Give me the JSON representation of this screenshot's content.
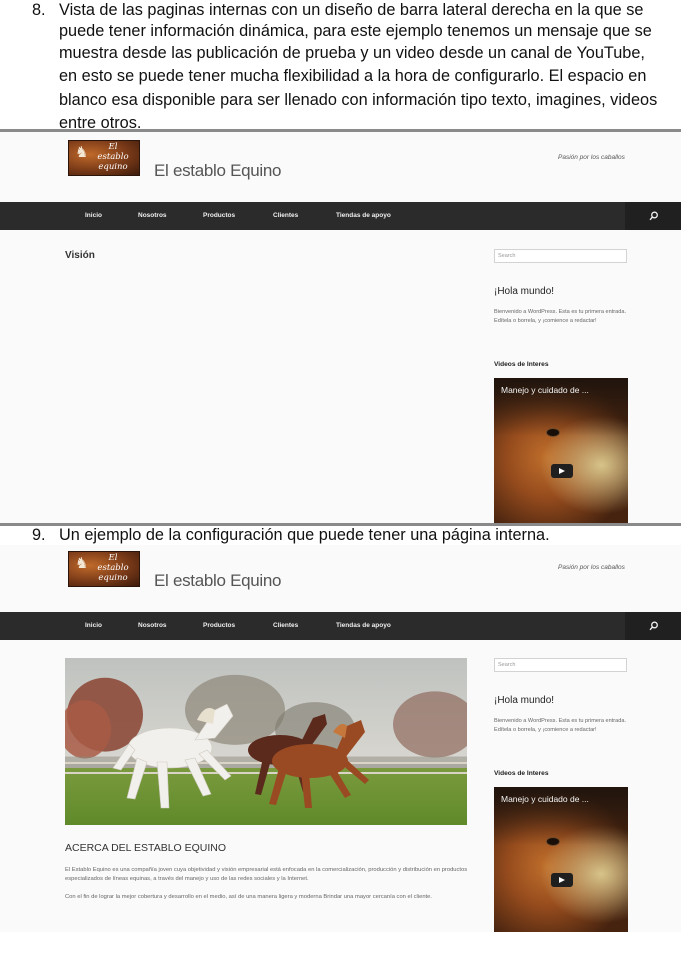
{
  "document": {
    "item8": {
      "number": "8.",
      "lines": [
        "Vista de las paginas internas con un diseño de barra lateral derecha en la que se",
        "puede tener información dinámica, para este ejemplo tenemos un mensaje que se",
        "muestra desde las publicación de prueba y un video desde un canal de YouTube,",
        "en esto se puede tener mucha flexibilidad a la hora de configurarlo.  El espacio en",
        "blanco esa disponible para ser llenado con información tipo texto, imagines, videos",
        "entre otros."
      ]
    },
    "item9": {
      "number": "9.",
      "text": "Un ejemplo de la configuración que puede tener una página interna."
    }
  },
  "site": {
    "logo_text": [
      "El",
      "establo",
      "equino"
    ],
    "title": "El establo Equino",
    "tagline": "Pasión por los caballos",
    "nav": [
      "Inicio",
      "Nosotros",
      "Productos",
      "Clientes",
      "Tiendas de apoyo"
    ],
    "search_placeholder": "Search",
    "widget_title": "¡Hola mundo!",
    "widget_text": "Bienvenido a WordPress. Esta es tu primera entrada. Edítela o borrela, y ¡comience a redactar!",
    "videos_title": "Videos de Interes",
    "video_title": "Manejo y cuidado de ..."
  },
  "screenshot1": {
    "page_heading": "Visión"
  },
  "screenshot2": {
    "content_title": "ACERCA DEL ESTABLO EQUINO",
    "paragraph1": "El Establo Equino es una compañía joven cuya objetividad y visión empresarial está enfocada en la comercialización, producción y distribución en productos especializados de líneas equinas, a través del manejo y uso de las redes sociales y la Internet.",
    "paragraph2": "Con el fin de lograr la mejor cobertura y desarrollo en el medio, así de una manera ligera y moderna Brindar una mayor cercanía con el cliente."
  },
  "colors": {
    "navbar": "#2b2b2b",
    "page_bg": "#fafafa",
    "logo": "#5a2a14"
  }
}
